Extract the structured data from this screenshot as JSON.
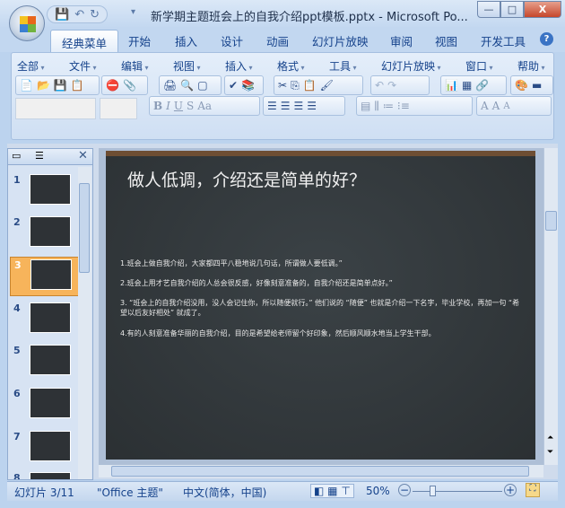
{
  "window": {
    "title": "新学期主题班会上的自我介绍ppt模板.pptx - Microsoft Po...",
    "minimize": "—",
    "maximize": "□",
    "close": "X"
  },
  "tabs": [
    "经典菜单",
    "开始",
    "插入",
    "设计",
    "动画",
    "幻灯片放映",
    "审阅",
    "视图",
    "开发工具"
  ],
  "help": "?",
  "menus": [
    "全部",
    "文件",
    "编辑",
    "视图",
    "插入",
    "格式",
    "工具",
    "幻灯片放映",
    "窗口",
    "帮助"
  ],
  "format_buttons": [
    "B",
    "I",
    "U",
    "S",
    "Aa"
  ],
  "font_size_buttons": [
    "A",
    "A",
    "A"
  ],
  "slides": {
    "numbers": [
      "1",
      "2",
      "3",
      "4",
      "5",
      "6",
      "7",
      "8"
    ],
    "selected": "3"
  },
  "slide": {
    "title": "做人低调，介绍还是简单的好？",
    "bullets": [
      "1.班会上做自我介绍，大家都四平八稳地说几句话，所谓做人要低调。”",
      "2.班会上用才艺自我介绍的人总会很反感，好像刻意准备的，自我介绍还是简单点好。”",
      "3. “班会上的自我介绍没用，没人会记住你，所以随便就行。” 他们说的 “随便” 也就是介绍一下名字，毕业学校，再加一句 “希望以后友好相处” 就成了。",
      "4.有的人刻意准备华丽的自我介绍，目的是希望给老师留个好印象，然后顺风顺水地当上学生干部。"
    ]
  },
  "status": {
    "slide": "幻灯片 3/11",
    "theme": "\"Office 主题\"",
    "language": "中文(简体，中国)",
    "zoom": "50%",
    "zoom_percent": 50
  }
}
